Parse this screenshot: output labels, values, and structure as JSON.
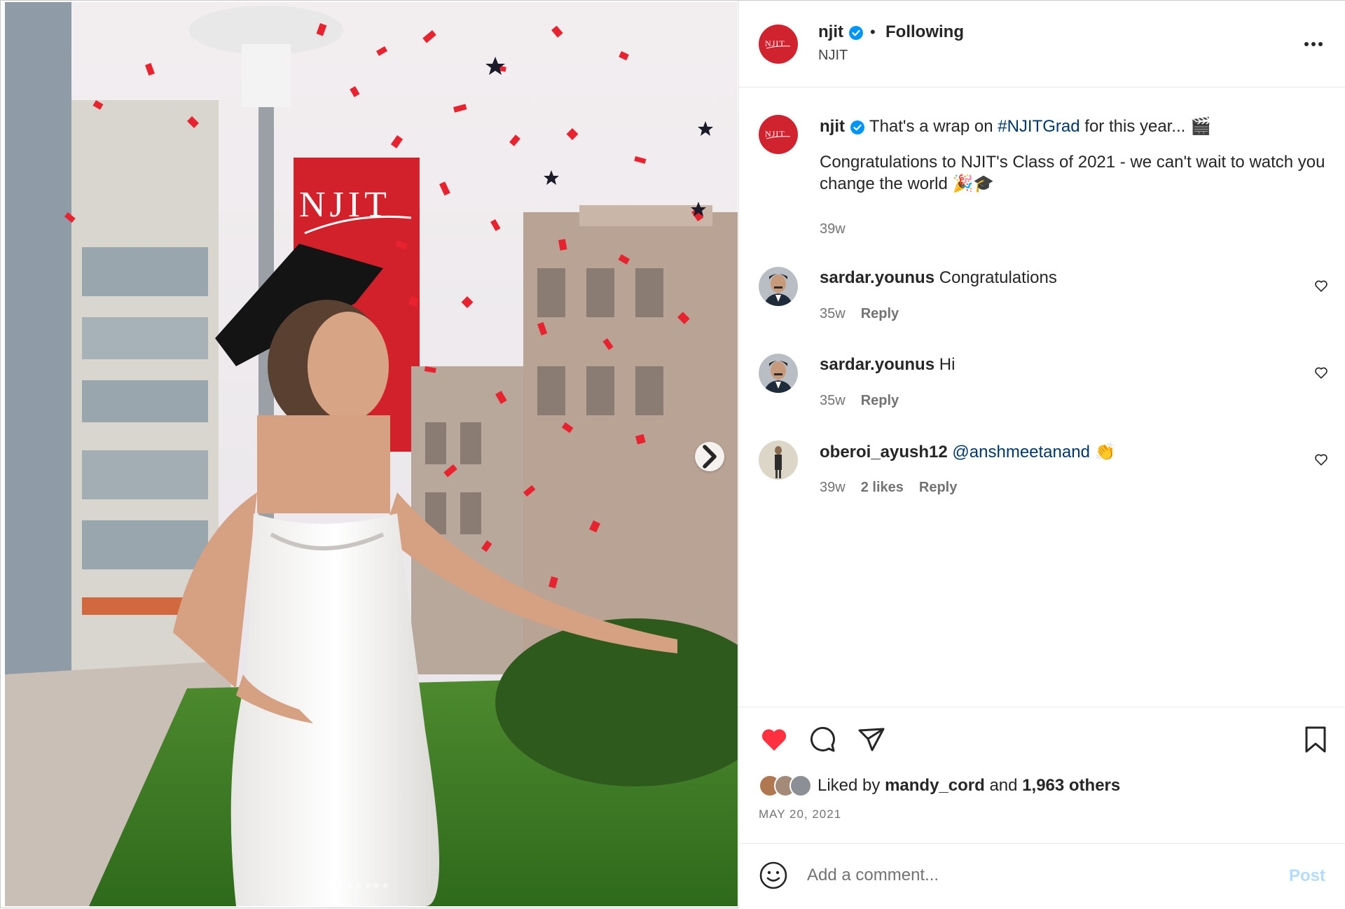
{
  "post": {
    "account": "njit",
    "separator": "•",
    "follow_status": "Following",
    "subtitle": "NJIT",
    "more_icon": "more-horizontal-icon",
    "banner_logo_text": "NJIT"
  },
  "caption": {
    "username": "njit",
    "text_before": "That's a wrap on ",
    "hashtag": "#NJITGrad",
    "text_after": " for this year... 🎬",
    "body": "Congratulations to NJIT's Class of 2021 - we can't wait to watch you change the world 🎉🎓",
    "time": "39w"
  },
  "comments": [
    {
      "username": "sardar.younus",
      "text": "Congratulations",
      "time": "35w",
      "likes": "",
      "reply": "Reply"
    },
    {
      "username": "sardar.younus",
      "text": "Hi",
      "time": "35w",
      "likes": "",
      "reply": "Reply"
    },
    {
      "username": "oberoi_ayush12",
      "mention": "@anshmeetanand",
      "emoji": "👏",
      "time": "39w",
      "likes": "2 likes",
      "reply": "Reply"
    }
  ],
  "likes": {
    "prefix": "Liked by ",
    "user": "mandy_cord",
    "middle": " and ",
    "count": "1,963 others"
  },
  "date": "MAY 20, 2021",
  "composer": {
    "placeholder": "Add a comment...",
    "post_label": "Post"
  },
  "carousel": {
    "total_slides": 7,
    "active_slide": 1
  },
  "colors": {
    "brand_red": "#d0222f",
    "liked_heart": "#ff3040",
    "link": "#00376b",
    "verified": "#0095f6",
    "post_disabled": "#b3dbff"
  }
}
